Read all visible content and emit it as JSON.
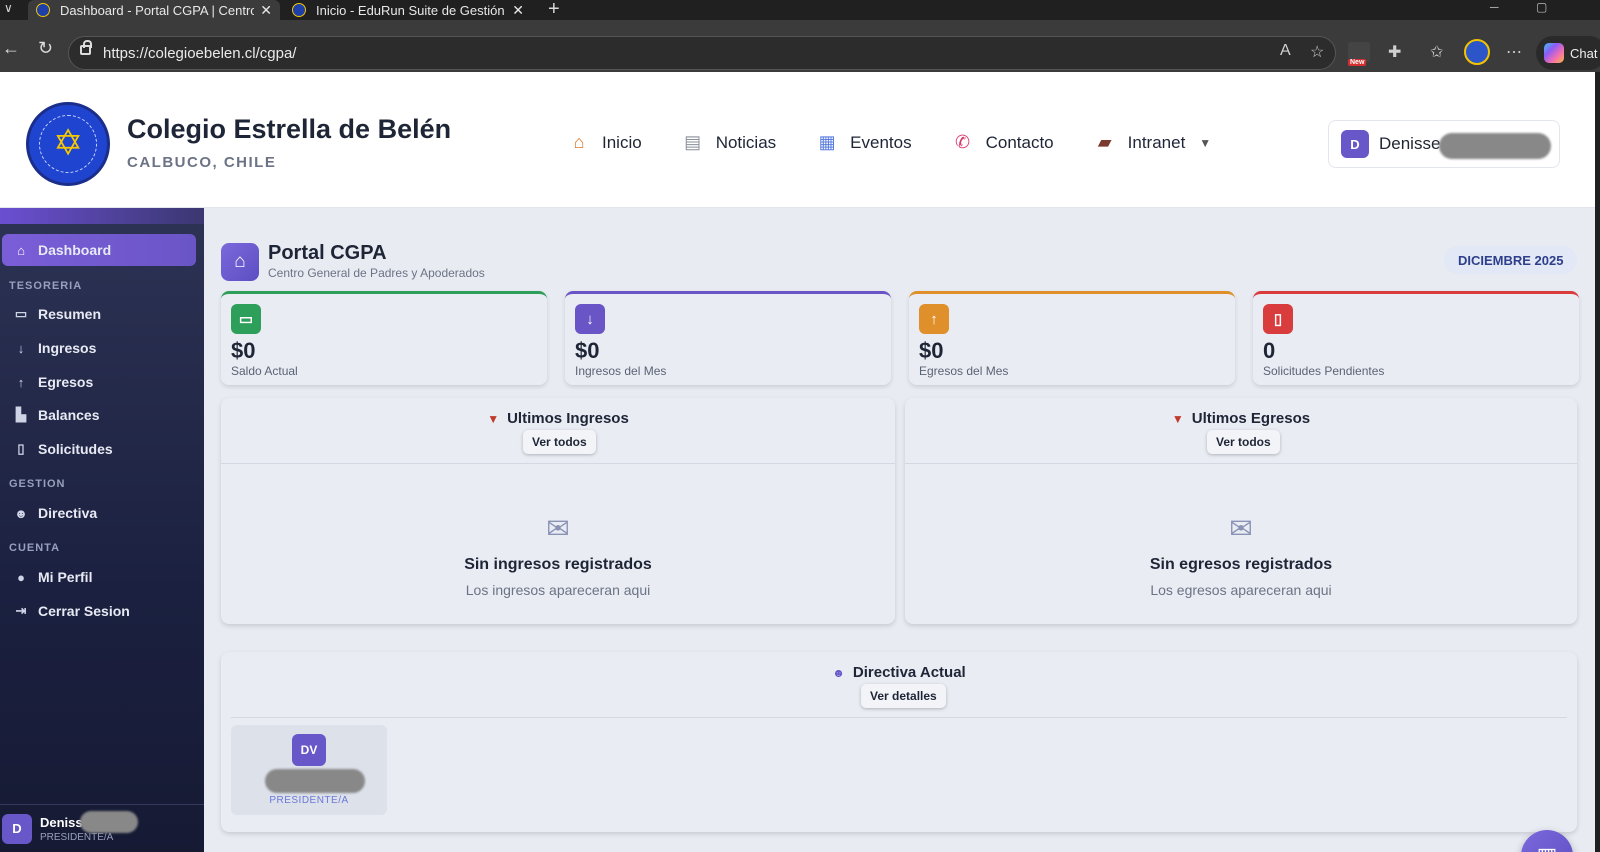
{
  "browser": {
    "tabs": [
      {
        "title": "Dashboard - Portal CGPA | Centro G",
        "active": true
      },
      {
        "title": "Inicio - EduRun Suite de Gestión Ed",
        "active": false
      }
    ],
    "url": "https://colegioebelen.cl/cgpa/",
    "new_badge": "New",
    "copilot_label": "Chat"
  },
  "header": {
    "school_name": "Colegio Estrella de Belén",
    "location": "CALBUCO, CHILE",
    "menu": [
      {
        "label": "Inicio",
        "icon": "house-icon"
      },
      {
        "label": "Noticias",
        "icon": "newspaper-icon"
      },
      {
        "label": "Eventos",
        "icon": "calendar-icon"
      },
      {
        "label": "Contacto",
        "icon": "phone-icon"
      },
      {
        "label": "Intranet",
        "icon": "briefcase-icon"
      }
    ],
    "user": {
      "initial": "D",
      "name": "Denisse"
    }
  },
  "sidebar": {
    "dashboard": "Dashboard",
    "sections": {
      "tesoreria": "TESORERIA",
      "gestion": "GESTION",
      "cuenta": "CUENTA"
    },
    "items": {
      "resumen": "Resumen",
      "ingresos": "Ingresos",
      "egresos": "Egresos",
      "balances": "Balances",
      "solicitudes": "Solicitudes",
      "directiva": "Directiva",
      "mi_perfil": "Mi Perfil",
      "cerrar_sesion": "Cerrar Sesion"
    },
    "user": {
      "initial": "D",
      "name": "Denisse",
      "role": "PRESIDENTE/A"
    }
  },
  "main": {
    "title": "Portal CGPA",
    "subtitle": "Centro General de Padres y Apoderados",
    "month": "DICIEMBRE 2025",
    "stats": [
      {
        "value": "$0",
        "label": "Saldo Actual",
        "color": "#2e9e5b",
        "icon": "wallet-icon"
      },
      {
        "value": "$0",
        "label": "Ingresos del Mes",
        "color": "#6a55c6",
        "icon": "arrow-down-icon"
      },
      {
        "value": "$0",
        "label": "Egresos del Mes",
        "color": "#e0902a",
        "icon": "arrow-up-icon"
      },
      {
        "value": "0",
        "label": "Solicitudes Pendientes",
        "color": "#d93c3c",
        "icon": "document-icon"
      }
    ],
    "ingresos_panel": {
      "title": "Ultimos Ingresos",
      "button": "Ver todos",
      "empty_title": "Sin ingresos registrados",
      "empty_sub": "Los ingresos apareceran aqui"
    },
    "egresos_panel": {
      "title": "Ultimos Egresos",
      "button": "Ver todos",
      "empty_title": "Sin egresos registrados",
      "empty_sub": "Los egresos apareceran aqui"
    },
    "directiva_panel": {
      "title": "Directiva Actual",
      "button": "Ver detalles",
      "member": {
        "initials": "DV",
        "role": "PRESIDENTE/A"
      }
    }
  }
}
